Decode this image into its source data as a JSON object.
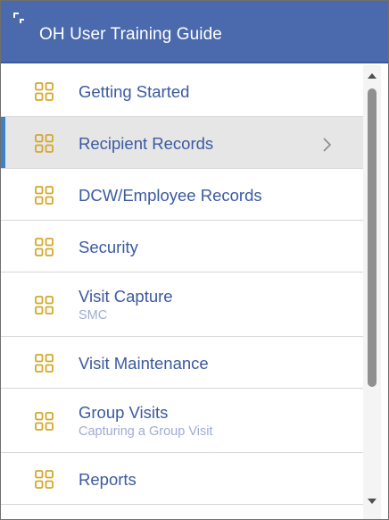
{
  "header": {
    "title": "OH User Training Guide",
    "expand_icon": "expand-icon",
    "background_color": "#4a6aad"
  },
  "colors": {
    "icon_gold": "#d4a72c",
    "label_blue": "#3b5aa0",
    "active_bar": "#3a83c4",
    "active_background": "#e6e6e6"
  },
  "menu": {
    "items": [
      {
        "label": "Getting Started",
        "subtitle": "",
        "icon": "grid-icon"
      },
      {
        "label": "Recipient Records",
        "subtitle": "",
        "icon": "grid-icon",
        "active": true,
        "has_submenu": true
      },
      {
        "label": "DCW/Employee Records",
        "subtitle": "",
        "icon": "grid-icon"
      },
      {
        "label": "Security",
        "subtitle": "",
        "icon": "grid-icon"
      },
      {
        "label": "Visit Capture",
        "subtitle": "SMC",
        "icon": "grid-icon"
      },
      {
        "label": "Visit Maintenance",
        "subtitle": "",
        "icon": "grid-icon"
      },
      {
        "label": "Group Visits",
        "subtitle": "Capturing a Group Visit",
        "icon": "grid-icon"
      },
      {
        "label": "Reports",
        "subtitle": "",
        "icon": "grid-icon"
      }
    ]
  },
  "scrollbar": {
    "up_icon": "scroll-up-arrow-icon",
    "down_icon": "scroll-down-arrow-icon"
  }
}
